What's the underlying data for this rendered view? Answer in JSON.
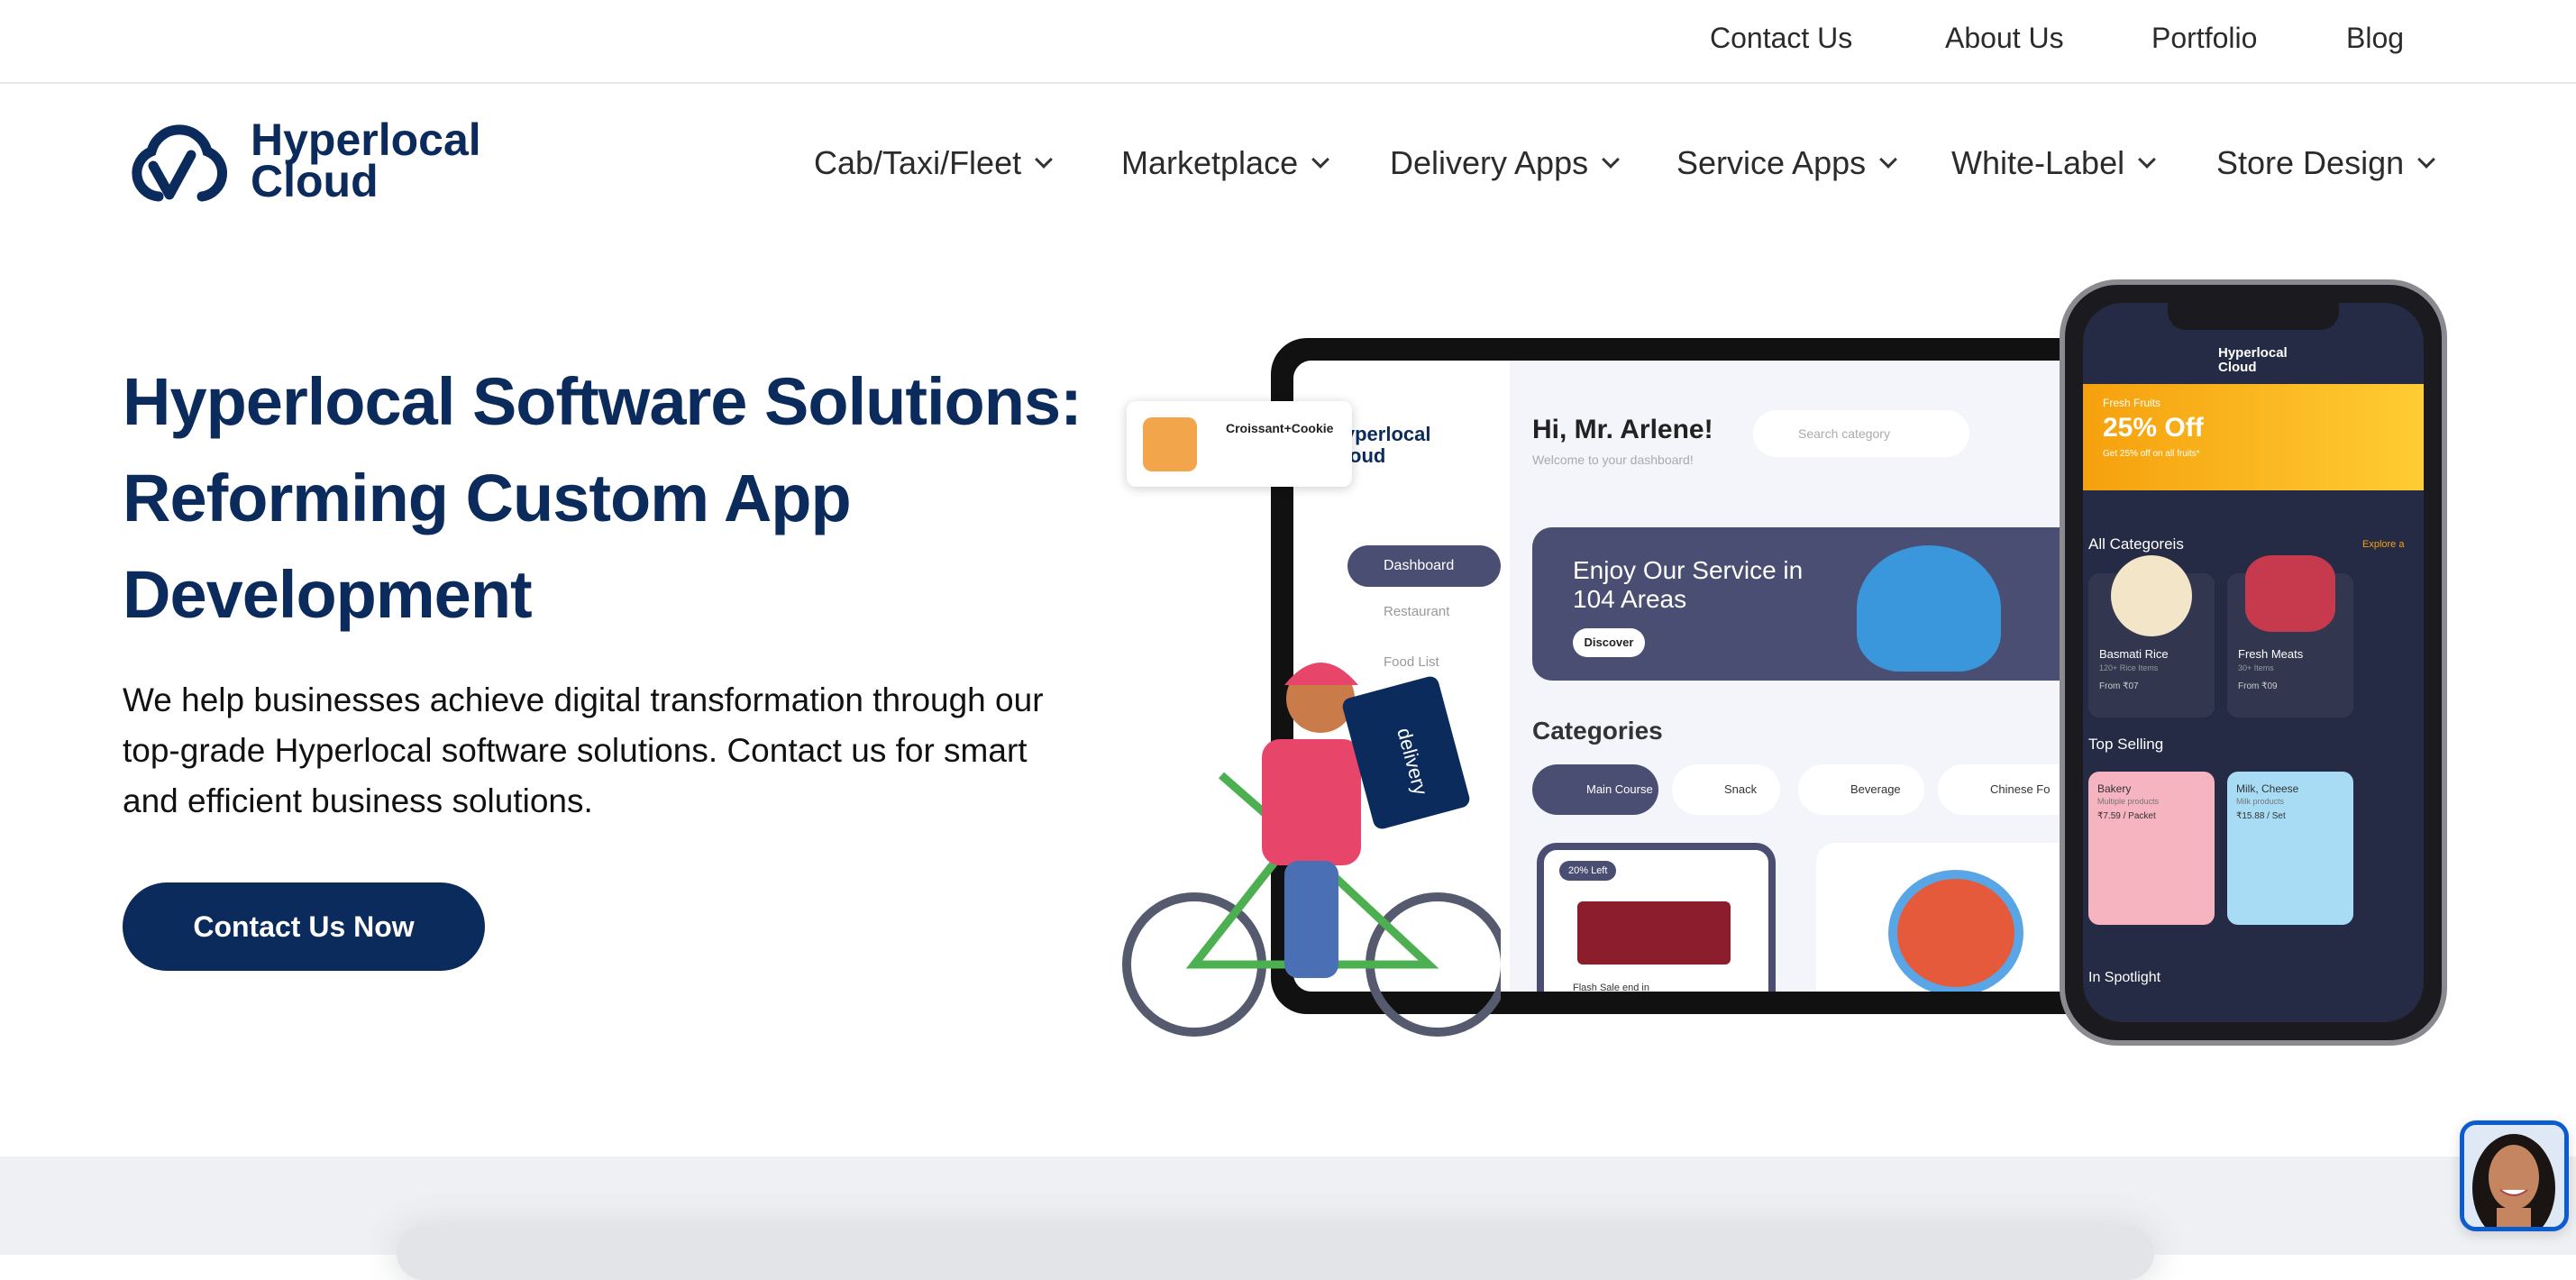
{
  "topbar": {
    "links": [
      "Contact Us",
      "About Us",
      "Portfolio",
      "Blog"
    ]
  },
  "logo": {
    "line1": "Hyperlocal",
    "line2": "Cloud"
  },
  "nav": {
    "items": [
      "Cab/Taxi/Fleet",
      "Marketplace",
      "Delivery Apps",
      "Service Apps",
      "White-Label",
      "Store Design"
    ]
  },
  "hero": {
    "title": "Hyperlocal Software Solutions: Reforming Custom App Development",
    "description": "We help businesses achieve digital transformation through our top-grade Hyperlocal software solutions. Contact us for smart and efficient business solutions.",
    "cta": "Contact Us Now"
  },
  "mockup": {
    "tablet": {
      "logo": "Hyperlocal Cloud",
      "greeting": "Hi, Mr. Arlene!",
      "welcome": "Welcome to your dashboard!",
      "search_placeholder": "Search category",
      "menu": [
        "Dashboard",
        "Restaurant",
        "Food List"
      ],
      "banner_title": "Enjoy Our Service in 104 Areas",
      "banner_button": "Discover",
      "categories_title": "Categories",
      "categories": [
        "Main Course",
        "Snack",
        "Beverage",
        "Chinese Fo"
      ],
      "card_badge": "20% Left",
      "flash_sale": "Flash Sale end in",
      "popup_item": "Croissant+Cookie",
      "bag_text": "delivery"
    },
    "phone": {
      "logo": "Hyperlocal Cloud",
      "promo_label": "Fresh Fruits",
      "promo_title": "25% Off",
      "promo_sub": "Get 25% off on all fruits*",
      "all_categories": "All Categoreis",
      "explore": "Explore a",
      "category_items": [
        {
          "name": "Basmati Rice",
          "count": "120+ Rice Items",
          "price": "From ₹07"
        },
        {
          "name": "Fresh Meats",
          "count": "30+ Items",
          "price": "From ₹09"
        }
      ],
      "top_selling": "Top Selling",
      "top_items": [
        {
          "name": "Bakery",
          "desc": "Multiple products",
          "price": "₹7.59 / Packet"
        },
        {
          "name": "Milk, Cheese",
          "desc": "Milk products",
          "price": "₹15.88 / Set"
        }
      ],
      "spotlight": "In Spotlight"
    }
  },
  "colors": {
    "brand": "#0b2b5c",
    "section_gray": "#eef0f4",
    "chat_border": "#0b5ccf"
  },
  "chat": {
    "icon": "support-agent-avatar"
  }
}
